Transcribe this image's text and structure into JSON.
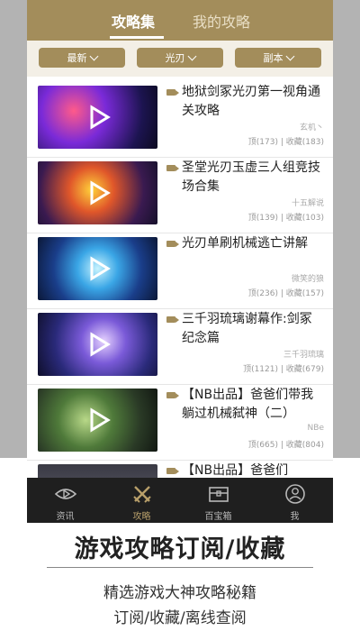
{
  "header": {
    "tabs": [
      {
        "label": "攻略集",
        "active": true
      },
      {
        "label": "我的攻略",
        "active": false
      }
    ]
  },
  "filters": [
    {
      "label": "最新"
    },
    {
      "label": "光刃"
    },
    {
      "label": "副本"
    }
  ],
  "list": [
    {
      "title": "地狱剑冢光刃第一视角通关攻略",
      "author": "玄机丶",
      "likes_label": "顶(173)",
      "favorites_label": "收藏(183)"
    },
    {
      "title": "圣堂光刃玉虚三人组竞技场合集",
      "author": "十五解说",
      "likes_label": "顶(139)",
      "favorites_label": "收藏(103)"
    },
    {
      "title": "光刃单刷机械逃亡讲解",
      "author": "微笑的狼",
      "likes_label": "顶(236)",
      "favorites_label": "收藏(157)"
    },
    {
      "title": "三千羽琉璃谢幕作:剑冢纪念篇",
      "author": "三千羽琉璃",
      "likes_label": "顶(1121)",
      "favorites_label": "收藏(679)"
    },
    {
      "title": "【NB出品】爸爸们带我躺过机械弑神（二）",
      "author": "NBe",
      "likes_label": "顶(665)",
      "favorites_label": "收藏(804)"
    },
    {
      "title": "【NB出品】爸爸们",
      "author": "",
      "likes_label": "",
      "favorites_label": ""
    }
  ],
  "stats_separator": "|",
  "nav": [
    {
      "label": "资讯",
      "icon": "eye-icon",
      "active": false
    },
    {
      "label": "攻略",
      "icon": "crossed-swords-icon",
      "active": true
    },
    {
      "label": "百宝箱",
      "icon": "treasure-chest-icon",
      "active": false
    },
    {
      "label": "我",
      "icon": "profile-icon",
      "active": false
    }
  ],
  "promo": {
    "headline": "游戏攻略订阅/收藏",
    "subline1": "精选游戏大神攻略秘籍",
    "subline2": "订阅/收藏/离线查阅"
  },
  "colors": {
    "accent": "#a38d5b",
    "nav_bg": "#1f1f1f",
    "nav_active": "#b89f6a"
  }
}
